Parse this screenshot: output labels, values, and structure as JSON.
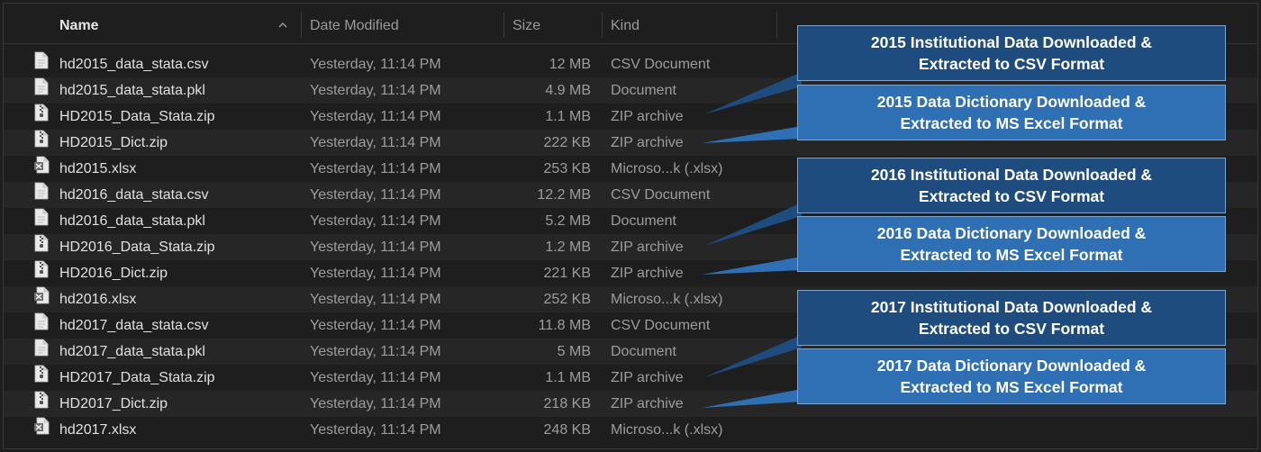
{
  "header": {
    "name_label": "Name",
    "date_label": "Date Modified",
    "size_label": "Size",
    "kind_label": "Kind",
    "sort_icon": "chevron-up-icon"
  },
  "files": [
    {
      "name": "hd2015_data_stata.csv",
      "date": "Yesterday, 11:14 PM",
      "size": "12 MB",
      "kind": "CSV Document",
      "icon": "document-icon"
    },
    {
      "name": "hd2015_data_stata.pkl",
      "date": "Yesterday, 11:14 PM",
      "size": "4.9 MB",
      "kind": "Document",
      "icon": "document-icon"
    },
    {
      "name": "HD2015_Data_Stata.zip",
      "date": "Yesterday, 11:14 PM",
      "size": "1.1 MB",
      "kind": "ZIP archive",
      "icon": "zip-icon"
    },
    {
      "name": "HD2015_Dict.zip",
      "date": "Yesterday, 11:14 PM",
      "size": "222 KB",
      "kind": "ZIP archive",
      "icon": "zip-icon"
    },
    {
      "name": "hd2015.xlsx",
      "date": "Yesterday, 11:14 PM",
      "size": "253 KB",
      "kind": "Microso...k (.xlsx)",
      "icon": "excel-icon"
    },
    {
      "name": "hd2016_data_stata.csv",
      "date": "Yesterday, 11:14 PM",
      "size": "12.2 MB",
      "kind": "CSV Document",
      "icon": "document-icon"
    },
    {
      "name": "hd2016_data_stata.pkl",
      "date": "Yesterday, 11:14 PM",
      "size": "5.2 MB",
      "kind": "Document",
      "icon": "document-icon"
    },
    {
      "name": "HD2016_Data_Stata.zip",
      "date": "Yesterday, 11:14 PM",
      "size": "1.2 MB",
      "kind": "ZIP archive",
      "icon": "zip-icon"
    },
    {
      "name": "HD2016_Dict.zip",
      "date": "Yesterday, 11:14 PM",
      "size": "221 KB",
      "kind": "ZIP archive",
      "icon": "zip-icon"
    },
    {
      "name": "hd2016.xlsx",
      "date": "Yesterday, 11:14 PM",
      "size": "252 KB",
      "kind": "Microso...k (.xlsx)",
      "icon": "excel-icon"
    },
    {
      "name": "hd2017_data_stata.csv",
      "date": "Yesterday, 11:14 PM",
      "size": "11.8 MB",
      "kind": "CSV Document",
      "icon": "document-icon"
    },
    {
      "name": "hd2017_data_stata.pkl",
      "date": "Yesterday, 11:14 PM",
      "size": "5 MB",
      "kind": "Document",
      "icon": "document-icon"
    },
    {
      "name": "HD2017_Data_Stata.zip",
      "date": "Yesterday, 11:14 PM",
      "size": "1.1 MB",
      "kind": "ZIP archive",
      "icon": "zip-icon"
    },
    {
      "name": "HD2017_Dict.zip",
      "date": "Yesterday, 11:14 PM",
      "size": "218 KB",
      "kind": "ZIP archive",
      "icon": "zip-icon"
    },
    {
      "name": "hd2017.xlsx",
      "date": "Yesterday, 11:14 PM",
      "size": "248 KB",
      "kind": "Microso...k (.xlsx)",
      "icon": "excel-icon"
    }
  ],
  "callouts": [
    {
      "line1": "2015 Institutional Data Downloaded &",
      "line2": "Extracted to CSV Format"
    },
    {
      "line1": "2015 Data Dictionary Downloaded &",
      "line2": "Extracted to MS Excel Format"
    },
    {
      "line1": "2016 Institutional Data Downloaded &",
      "line2": "Extracted to CSV Format"
    },
    {
      "line1": "2016 Data Dictionary Downloaded &",
      "line2": "Extracted to MS Excel Format"
    },
    {
      "line1": "2017 Institutional Data Downloaded &",
      "line2": "Extracted to CSV Format"
    },
    {
      "line1": "2017 Data Dictionary Downloaded &",
      "line2": "Extracted to MS Excel Format"
    }
  ],
  "colors": {
    "window_bg": "#1e1e1e",
    "row_alt": "#262626",
    "callout_dark": "#1f4c7f",
    "callout_light": "#2f6fb3"
  }
}
